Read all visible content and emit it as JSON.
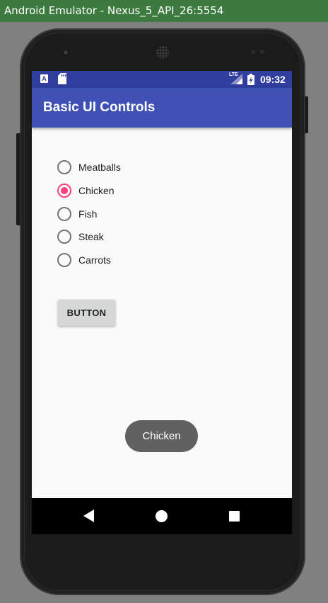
{
  "window": {
    "title": "Android Emulator - Nexus_5_API_26:5554"
  },
  "status_bar": {
    "app_icon_letter": "A",
    "network": "LTE",
    "time": "09:32",
    "icons": [
      "a-notification-icon",
      "sd-card-icon",
      "signal-icon",
      "battery-icon"
    ]
  },
  "app_bar": {
    "title": "Basic UI Controls"
  },
  "radio_group": {
    "options": [
      {
        "label": "Meatballs",
        "checked": false
      },
      {
        "label": "Chicken",
        "checked": true
      },
      {
        "label": "Fish",
        "checked": false
      },
      {
        "label": "Steak",
        "checked": false
      },
      {
        "label": "Carrots",
        "checked": false
      }
    ]
  },
  "button": {
    "label": "BUTTON"
  },
  "toast": {
    "text": "Chicken"
  },
  "nav_bar": {
    "icons": [
      "back-icon",
      "home-icon",
      "recents-icon"
    ]
  },
  "colors": {
    "primary": "#3f51b5",
    "primary_dark": "#303f9f",
    "accent": "#ff4081",
    "window_titlebar": "#3c7a3f"
  }
}
